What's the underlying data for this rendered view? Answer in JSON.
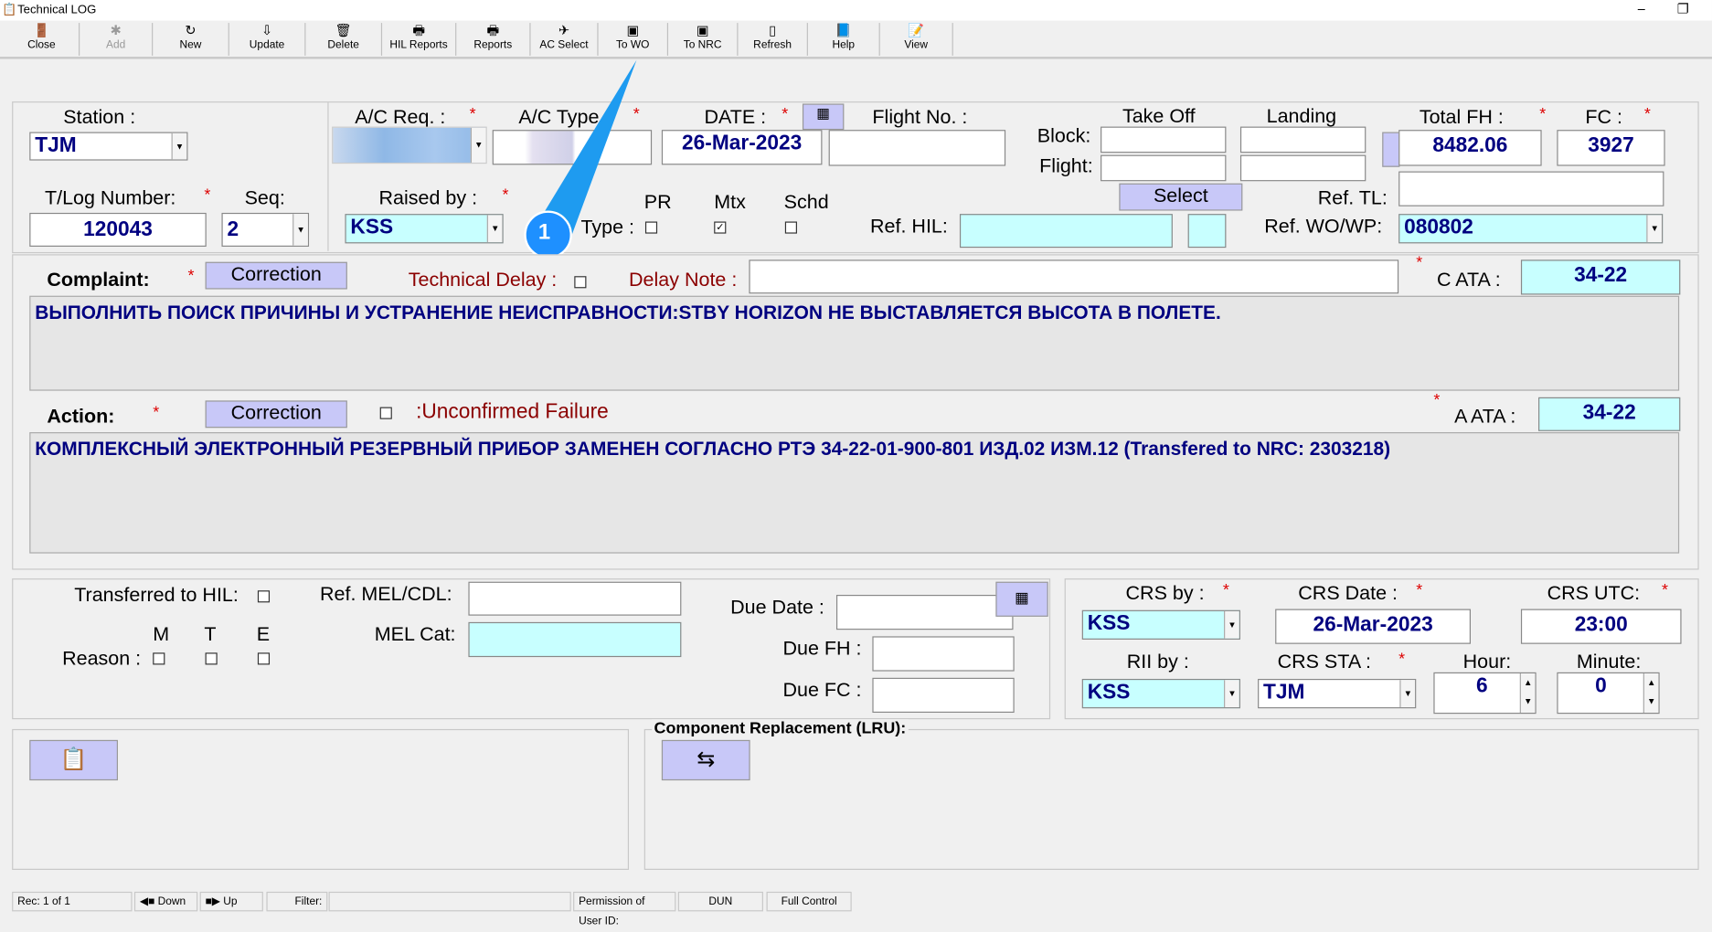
{
  "window": {
    "title": "Technical LOG"
  },
  "toolbar": [
    {
      "label": "Close",
      "icon": "door-icon"
    },
    {
      "label": "Add",
      "icon": "add-icon"
    },
    {
      "label": "New",
      "icon": "new-icon"
    },
    {
      "label": "Update",
      "icon": "update-icon"
    },
    {
      "label": "Delete",
      "icon": "trash-icon"
    },
    {
      "label": "HIL Reports",
      "icon": "printer-icon"
    },
    {
      "label": "Reports",
      "icon": "printer-icon"
    },
    {
      "label": "AC Select",
      "icon": "aircraft-icon"
    },
    {
      "label": "To WO",
      "icon": "transfer-icon"
    },
    {
      "label": "To NRC",
      "icon": "transfer-icon"
    },
    {
      "label": "Refresh",
      "icon": "page-icon"
    },
    {
      "label": "Help",
      "icon": "book-icon"
    },
    {
      "label": "View",
      "icon": "view-icon"
    }
  ],
  "header": {
    "station_label": "Station :",
    "station": "TJM",
    "tlog_label": "T/Log Number:",
    "tlog": "120043",
    "seq_label": "Seq:",
    "seq": "2",
    "acreg_label": "A/C Req. :",
    "actype_label": "A/C Type :",
    "date_label": "DATE :",
    "date": "26-Mar-2023",
    "flight_label": "Flight No. :",
    "raised_label": "Raised by :",
    "raised": "KSS",
    "type_label": "Type :",
    "pr": "PR",
    "mtx": "Mtx",
    "schd": "Schd",
    "takeoff": "Take Off",
    "landing": "Landing",
    "block": "Block:",
    "flight": "Flight:",
    "select": "Select",
    "ref_hil": "Ref. HIL:",
    "total_fh_label": "Total FH :",
    "total_fh": "8482.06",
    "fc_label": "FC :",
    "fc": "3927",
    "ref_tl": "Ref. TL:",
    "ref_wo_label": "Ref. WO/WP:",
    "ref_wo": "080802",
    "callout": "1"
  },
  "complaint": {
    "label": "Complaint:",
    "correction": "Correction",
    "tech_delay": "Technical Delay :",
    "delay_note": "Delay Note :",
    "ata_label": "C  ATA :",
    "ata": "34-22",
    "text": "ВЫПОЛНИТЬ ПОИСК ПРИЧИНЫ И УСТРАНЕНИЕ НЕИСПРАВНОСТИ:STBY HORIZON НЕ  ВЫСТАВЛЯЕТСЯ ВЫСОТА В ПОЛЕТЕ."
  },
  "action": {
    "label": "Action:",
    "correction": "Correction",
    "unconfirmed": ":Unconfirmed Failure",
    "ata_label": "A  ATA :",
    "ata": "34-22",
    "text": "КОМПЛЕКСНЫЙ ЭЛЕКТРОННЫЙ РЕЗЕРВНЫЙ ПРИБОР ЗАМЕНЕН СОГЛАСНО РТЭ 34-22-01-900-801 ИЗД.02 ИЗМ.12 (Transfered to NRC: 2303218)"
  },
  "deferral": {
    "transferred": "Transferred to HIL:",
    "m": "M",
    "t": "T",
    "e": "E",
    "reason": "Reason :",
    "ref_mel": "Ref. MEL/CDL:",
    "mel_cat": "MEL Cat:",
    "due_date": "Due Date :",
    "due_fh": "Due FH :",
    "due_fc": "Due FC :"
  },
  "crs": {
    "crs_by_label": "CRS by :",
    "crs_by": "KSS",
    "crs_date_label": "CRS Date :",
    "crs_date": "26-Mar-2023",
    "crs_utc_label": "CRS UTC:",
    "crs_utc": "23:00",
    "rii_label": "RII by :",
    "rii": "KSS",
    "sta_label": "CRS STA :",
    "sta": "TJM",
    "hour_label": "Hour:",
    "hour": "6",
    "minute_label": "Minute:",
    "minute": "0"
  },
  "lru": {
    "label": "Component Replacement (LRU):"
  },
  "status": {
    "rec": "Rec: 1 of 1",
    "down": "Down",
    "up": "Up",
    "filter": "Filter:",
    "perm": "Permission of User ID:",
    "user": "DUN",
    "access": "Full Control"
  }
}
